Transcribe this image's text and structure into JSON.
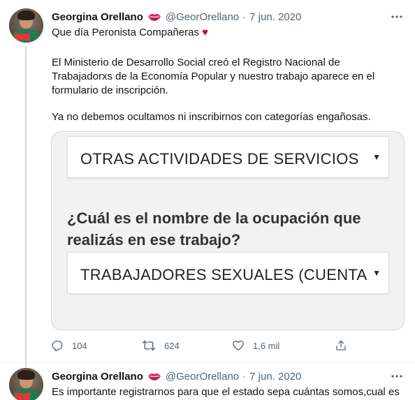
{
  "tweets": [
    {
      "author": {
        "name": "Georgina Orellano",
        "handle": "@GeorOrellano",
        "separator": "·",
        "date": "7 jun. 2020"
      },
      "text": {
        "line1": "Que día Peronista Compañeras",
        "heart": "♥",
        "paragraph2": "El Ministerio de Desarrollo Social creó el Registro Nacional de Trabajadorxs de la Economía Popular y nuestro trabajo aparece en el formulario de inscripción.",
        "paragraph3": "Ya no debemos ocultamos ni inscribirnos con categorías engañosas."
      },
      "media": {
        "field1_value": "OTRAS ACTIVIDADES DE SERVICIOS",
        "question": "¿Cuál es el nombre de la ocupación que realizás en ese trabajo?",
        "field2_value": "TRABAJADORES SEXUALES (CUENTAPROPIA)",
        "caret": "▼"
      },
      "actions": {
        "reply_count": "104",
        "retweet_count": "624",
        "like_count": "1,6 mil"
      }
    },
    {
      "author": {
        "name": "Georgina Orellano",
        "handle": "@GeorOrellano",
        "separator": "·",
        "date": "7 jun. 2020"
      },
      "text": {
        "line1": "Es importante registrarnos para que el estado sepa cuántas somos,cual es"
      }
    }
  ],
  "icons": {
    "kiss": "kiss-mark-icon",
    "more": "more-icon",
    "reply": "reply-icon",
    "retweet": "retweet-icon",
    "like": "like-icon",
    "share": "share-icon"
  },
  "colors": {
    "text": "#0f1419",
    "secondary": "#536471",
    "border": "#cfd9de",
    "heart": "#d0021b",
    "lips": "#e0245e"
  }
}
